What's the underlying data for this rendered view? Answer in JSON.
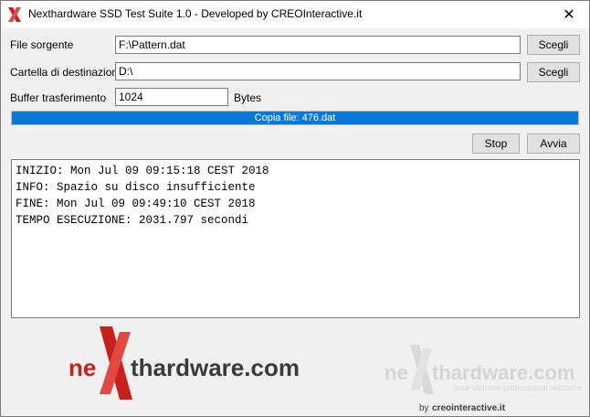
{
  "window": {
    "title": "Nexthardware SSD Test Suite 1.0 - Developed by CREOInteractive.it",
    "close_glyph": "✕"
  },
  "form": {
    "source": {
      "label": "File sorgente",
      "value": "F:\\Pattern.dat",
      "button": "Scegli"
    },
    "destination": {
      "label": "Cartella di destinazione",
      "value": "D:\\",
      "button": "Scegli"
    },
    "buffer": {
      "label": "Buffer trasferimento",
      "value": "1024",
      "unit": "Bytes"
    }
  },
  "progress": {
    "text": "Copia file: 476.dat",
    "percent": 100
  },
  "actions": {
    "stop": "Stop",
    "start": "Avvia"
  },
  "log": {
    "lines": [
      "INIZIO: Mon Jul 09 09:15:18 CEST 2018",
      "INFO: Spazio su disco insufficiente",
      "FINE: Mon Jul 09 09:49:10 CEST 2018",
      "TEMPO ESECUZIONE: 2031.797 secondi"
    ]
  },
  "branding": {
    "logo_left": {
      "prefix": "ne",
      "suffix": "thardware.com"
    },
    "logo_right": {
      "prefix": "ne",
      "suffix": "thardware.com",
      "tagline": "your ultimate professional resource",
      "credit_prefix": "by ",
      "credit_name": "creointeractive.it"
    }
  },
  "colors": {
    "accent": "#0a78d7",
    "brand_red": "#c8201c",
    "brand_dark": "#3a3a3a"
  },
  "icons": {
    "app": "x-logo-icon",
    "close": "close-icon"
  }
}
